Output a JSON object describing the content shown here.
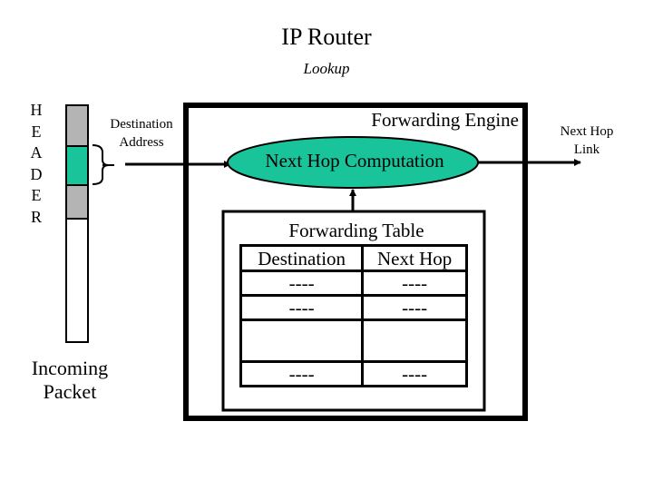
{
  "title": "IP Router",
  "subtitle": "Lookup",
  "packet": {
    "header_letters": [
      "H",
      "E",
      "A",
      "D",
      "E",
      "R"
    ],
    "label_line1": "Incoming",
    "label_line2": "Packet",
    "segment_colors": {
      "header": "#b4b4b4",
      "destination": "#19c49a",
      "payload": "#ffffff"
    }
  },
  "destination_address": {
    "line1": "Destination",
    "line2": "Address"
  },
  "forwarding_engine": {
    "label": "Forwarding Engine",
    "computation": {
      "label": "Next Hop Computation",
      "color": "#19c49a"
    },
    "forwarding_table": {
      "title": "Forwarding Table",
      "columns": [
        "Destination",
        "Next Hop"
      ],
      "rows": [
        [
          "----",
          "----"
        ],
        [
          "----",
          "----"
        ],
        [
          "",
          ""
        ],
        [
          "----",
          "----"
        ]
      ]
    }
  },
  "next_hop_link": {
    "line1": "Next Hop",
    "line2": "Link"
  }
}
